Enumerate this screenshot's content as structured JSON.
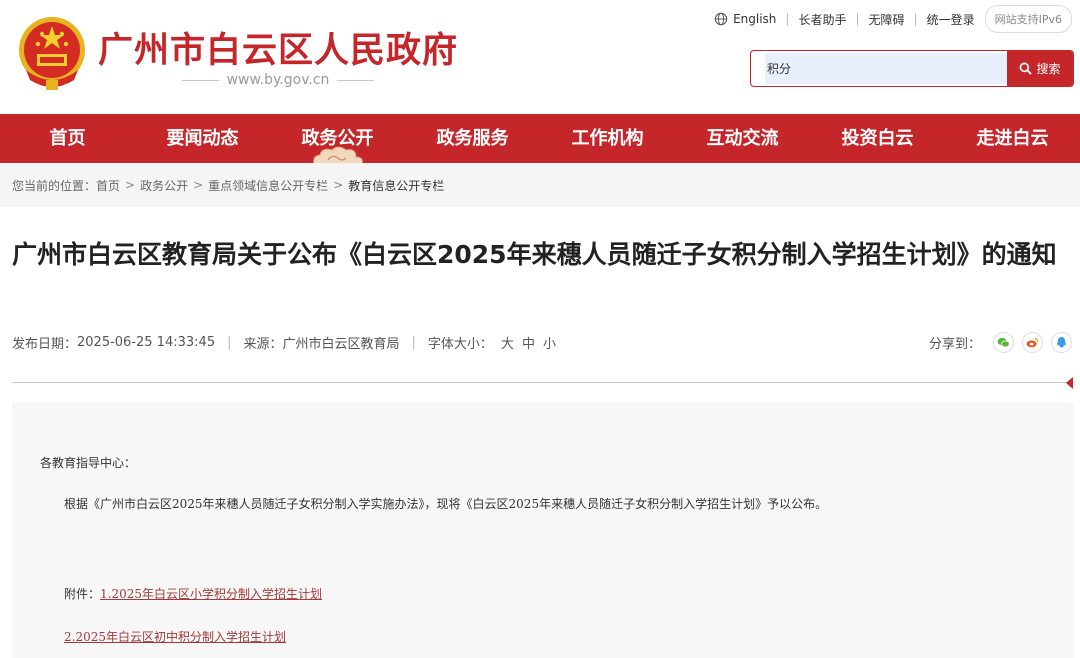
{
  "header": {
    "site_title": "广州市白云区人民政府",
    "site_url": "www.by.gov.cn",
    "top_links": {
      "english": "English",
      "elder": "长者助手",
      "accessible": "无障碍",
      "login": "统一登录",
      "ipv6": "网站支持IPv6"
    },
    "search": {
      "value": "积分",
      "button": "搜索"
    }
  },
  "nav": {
    "items": [
      "首页",
      "要闻动态",
      "政务公开",
      "政务服务",
      "工作机构",
      "互动交流",
      "投资白云",
      "走进白云"
    ]
  },
  "breadcrumb": {
    "prefix": "您当前的位置：",
    "items": [
      "首页",
      "政务公开",
      "重点领域信息公开专栏"
    ],
    "current": "教育信息公开专栏"
  },
  "article": {
    "title": "广州市白云区教育局关于公布《白云区2025年来穗人员随迁子女积分制入学招生计划》的通知",
    "publish_label": "发布日期：",
    "publish_date": "2025-06-25 14:33:45",
    "source_label": "来源：",
    "source": "广州市白云区教育局",
    "font_label": "字体大小：",
    "font_sizes": [
      "大",
      "中",
      "小"
    ],
    "share_label": "分享到：",
    "share_icons": [
      "wechat-icon",
      "weibo-icon",
      "qq-icon"
    ],
    "body": {
      "salutation": "各教育指导中心：",
      "paragraph": "根据《广州市白云区2025年来穗人员随迁子女积分制入学实施办法》，现将《白云区2025年来穗人员随迁子女积分制入学招生计划》予以公布。",
      "attachment_label": "附件：",
      "attachments": [
        "1.2025年白云区小学积分制入学招生计划",
        "2.2025年白云区初中积分制入学招生计划"
      ]
    }
  },
  "colors": {
    "brand_red": "#c4262a",
    "crumb_bg": "#f5f5f5",
    "content_bg": "#f7f7f7"
  }
}
